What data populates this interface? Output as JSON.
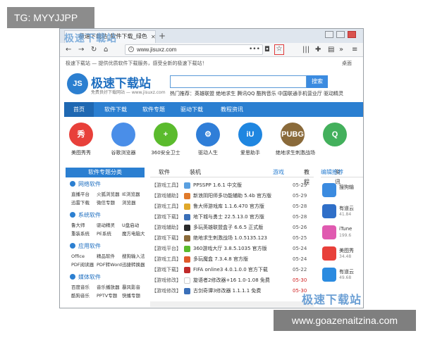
{
  "overlay": {
    "top_left_tag": "TG: MYYJJPP",
    "bottom_right_tag": "www.goazenaitzina.com",
    "watermark": "极速下载站"
  },
  "browser": {
    "tab_title": "极速下载站_软件下载_绿色",
    "new_tab": "+",
    "url": "www.jisuxz.com",
    "url_dots": "•••"
  },
  "site": {
    "topbar_text": "极速下载站 — 提供优质软件下载服务，感受全新的极速下载站！",
    "topbar_right": "桌面",
    "logo_mark": "JS",
    "logo_title": "极速下载站",
    "logo_sub": "免费良好下载网站 — www.jisuxz.com",
    "search_button": "搜索",
    "hot_search": "热门推荐：英雄联盟  绝地求生  腾讯QQ  酷狗音乐  中国联通手机营业厅  驱动精灵",
    "main_nav": [
      "首页",
      "软件下载",
      "软件专题",
      "驱动下载",
      "教程资讯"
    ],
    "apps": [
      {
        "label": "美图秀秀",
        "color": "#e8403a",
        "glyph": "秀"
      },
      {
        "label": "谷歌浏览器",
        "color": "#4a8ee8",
        "glyph": ""
      },
      {
        "label": "360安全卫士",
        "color": "#5bbb2d",
        "glyph": "+"
      },
      {
        "label": "驱动人生",
        "color": "#2f7ed8",
        "glyph": "⚙"
      },
      {
        "label": "爱思助手",
        "color": "#1f86e0",
        "glyph": "iU"
      },
      {
        "label": "绝地求生刺激战场",
        "color": "#8a6a3a",
        "glyph": "PUBG"
      },
      {
        "label": "",
        "color": "#43b05c",
        "glyph": "Q"
      }
    ],
    "sidebar": {
      "header": "软件专题分类",
      "sections": [
        {
          "title": "网络软件",
          "rows": [
            [
              "直播平台",
              "火狐浏览器",
              "IE浏览器"
            ],
            [
              "迅雷下载",
              "微信专题",
              "浏览器"
            ]
          ]
        },
        {
          "title": "系统软件",
          "rows": [
            [
              "鲁大师",
              "驱动精灵",
              "U盘启动"
            ],
            [
              "重装系统",
              "PE系统",
              "魔方电脑大"
            ]
          ]
        },
        {
          "title": "应用软件",
          "rows": [
            [
              "Office",
              "精品软件",
              "搜狗输入法"
            ],
            [
              "PDF阅读器",
              "PDF转Word",
              "迅捷转换器"
            ]
          ]
        },
        {
          "title": "媒体软件",
          "rows": [
            [
              "百度音乐",
              "音乐播放器",
              "暴风影音"
            ],
            [
              "酷狗音乐",
              "PPTV专题",
              "快播专题"
            ]
          ]
        }
      ]
    },
    "tabs": [
      "软件",
      "装机",
      "游戏",
      "教程",
      "资讯"
    ],
    "active_tab": "游戏",
    "games": [
      {
        "cat": "【游戏工具】",
        "name": "PPSSPP 1.6.1 中文版",
        "date": "05-29",
        "color": "#5aa0e0"
      },
      {
        "cat": "【游戏辅助】",
        "name": "新浪阴阳师多功能辅助 5.4b 官方版",
        "date": "05-29",
        "color": "#e07a2a"
      },
      {
        "cat": "【游戏工具】",
        "name": "鲁大师游戏库 1.1.6.470 官方版",
        "date": "05-28",
        "color": "#e0a82a"
      },
      {
        "cat": "【游戏下载】",
        "name": "地下城与勇士 22.5.13.0 官方版",
        "date": "05-28",
        "color": "#3a6fb8"
      },
      {
        "cat": "【游戏辅助】",
        "name": "多玩英雄联盟盒子 6.6.5 正式版",
        "date": "05-26",
        "color": "#2a2a2a"
      },
      {
        "cat": "【游戏下载】",
        "name": "绝地求生刺激战场 1.0.5135.123",
        "date": "05-25",
        "color": "#8a6a3a"
      },
      {
        "cat": "【游戏平台】",
        "name": "360游戏大厅 3.8.5.1035 官方版",
        "date": "05-24",
        "color": "#5bbb2d"
      },
      {
        "cat": "【游戏工具】",
        "name": "多玩魔盒 7.3.4.8 官方版",
        "date": "05-24",
        "color": "#e05a2a"
      },
      {
        "cat": "【游戏下载】",
        "name": "FIFA online3 4.0.1.0.0 官方下载",
        "date": "05-22",
        "color": "#c02a2a"
      },
      {
        "cat": "【游戏修改】",
        "name": "旋语者2修改器+16 1.0-1.08 免费",
        "date": "05-30",
        "color": "#ffffff",
        "red": true
      },
      {
        "cat": "【游戏修改】",
        "name": "古剑奇谭3修改器 1.1.1.1 免费",
        "date": "05-30",
        "color": "#3a6fb8",
        "red": true
      }
    ],
    "recommend": {
      "header": "编辑推荐",
      "items": [
        {
          "name": "搜狗输",
          "size": "",
          "color": "#3b8be0"
        },
        {
          "name": "有道云",
          "size": "41.84",
          "color": "#2f6fc8"
        },
        {
          "name": "iTune",
          "size": "199.6",
          "color": "#e05ab0"
        },
        {
          "name": "美图秀",
          "size": "34.48",
          "color": "#e8403a"
        },
        {
          "name": "有道云",
          "size": "49.68",
          "color": "#2b8be0"
        }
      ]
    }
  }
}
